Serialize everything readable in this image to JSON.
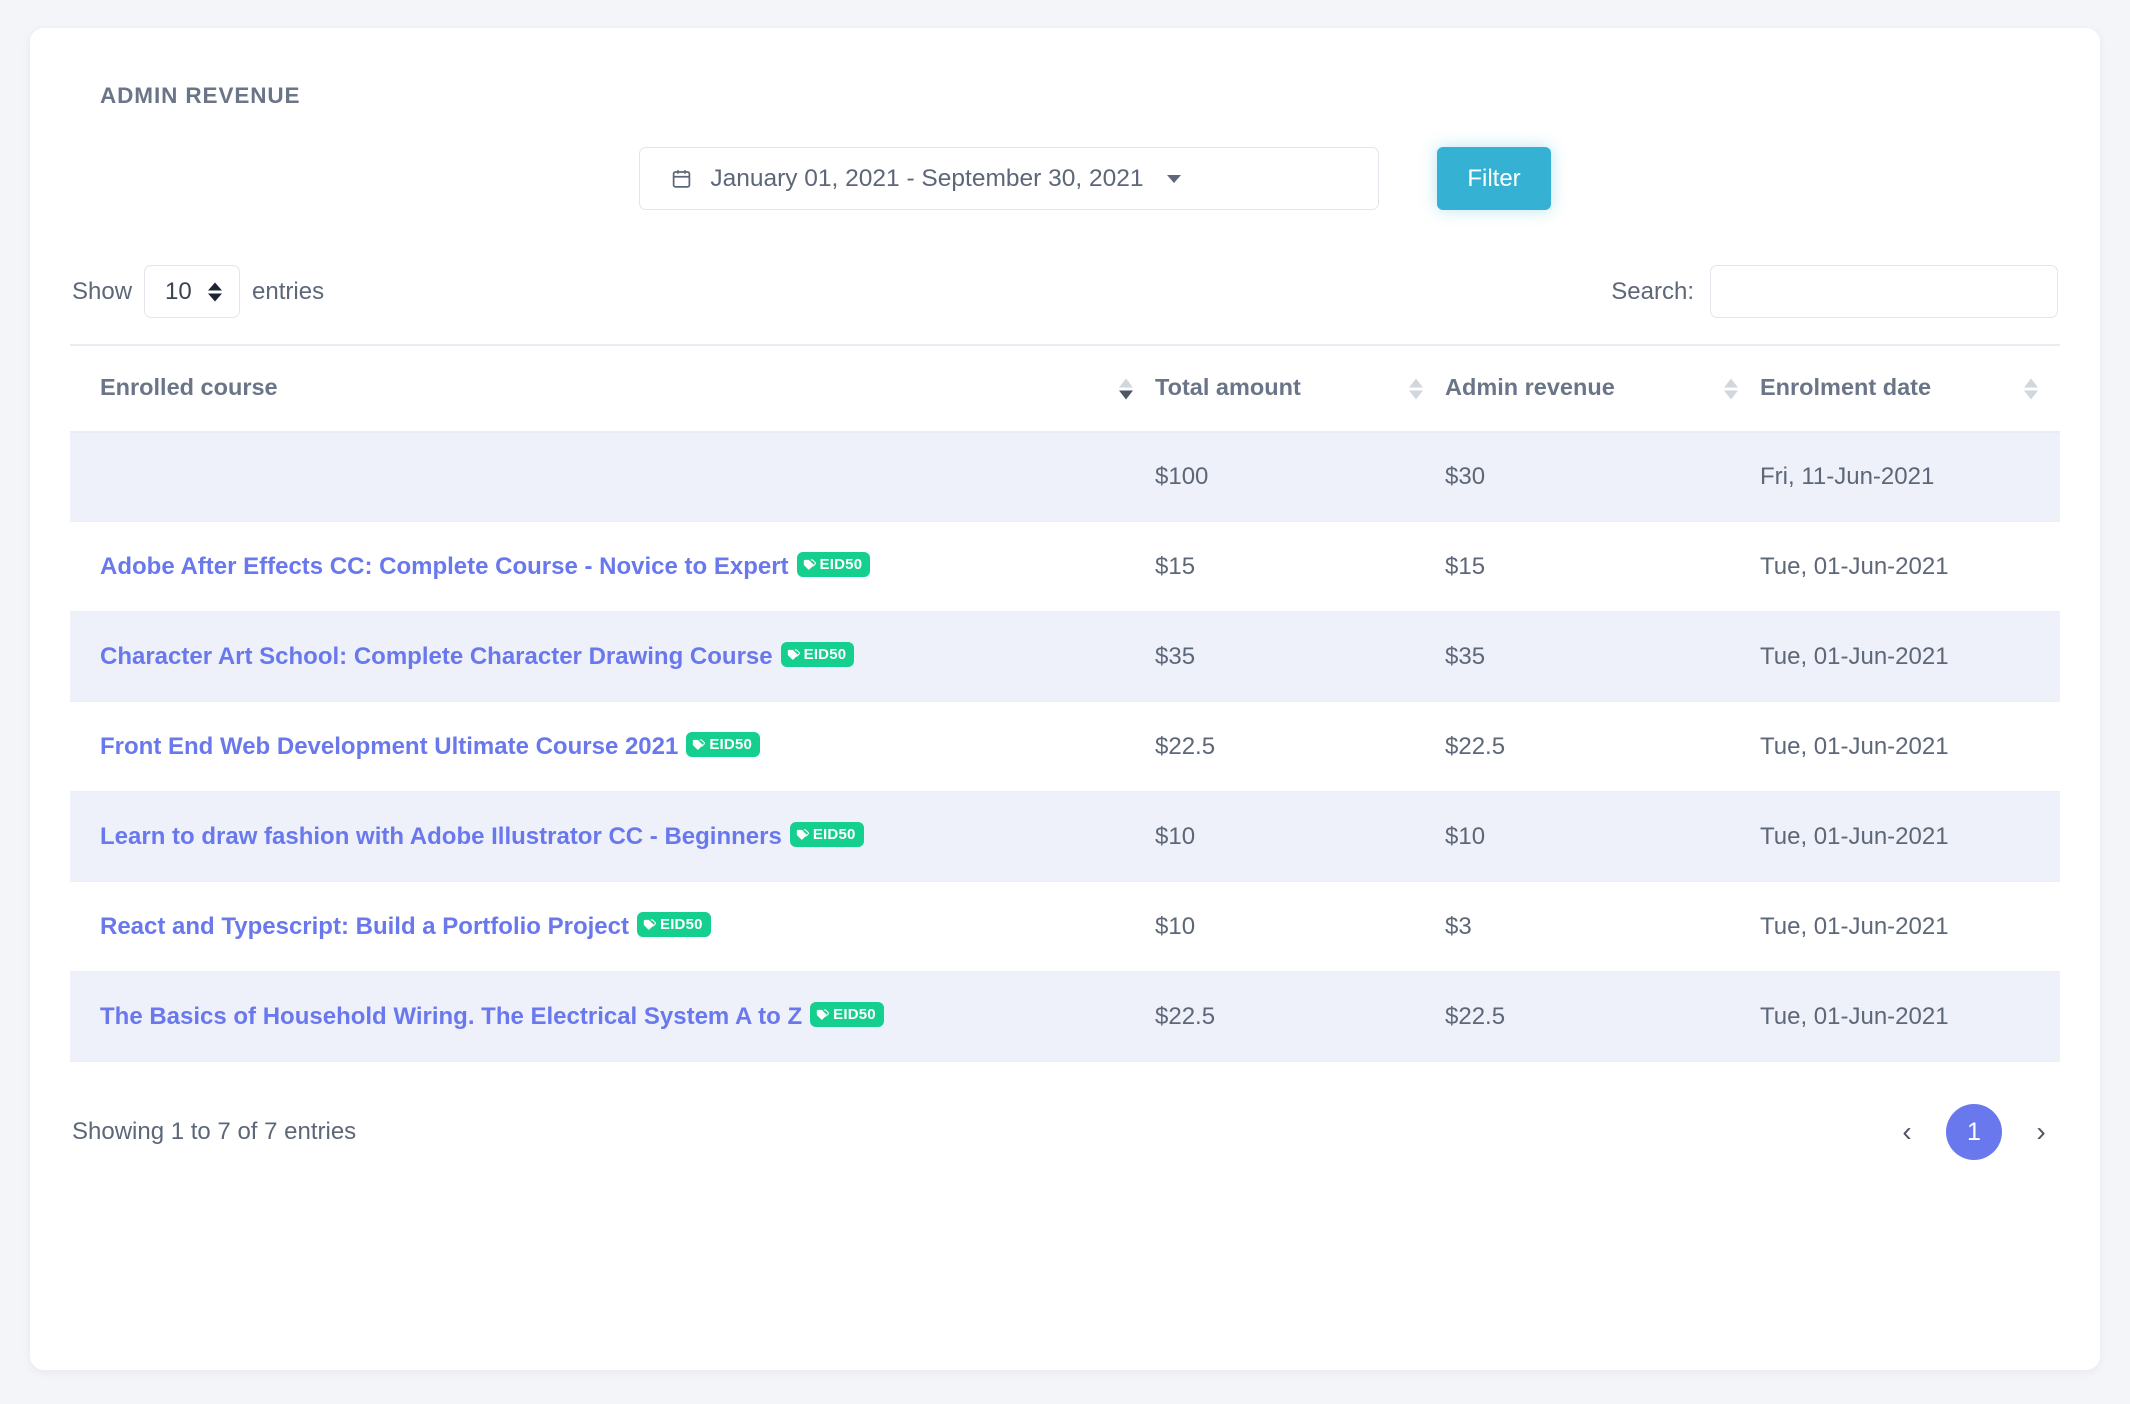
{
  "card": {
    "title": "ADMIN REVENUE"
  },
  "filter": {
    "date_range": "January 01, 2021 - September 30, 2021",
    "calendar_icon": "calendar-icon",
    "caret_icon": "chevron-down-icon",
    "filter_button": "Filter",
    "filter_button_color": "#35b2d3"
  },
  "controls": {
    "show_label": "Show",
    "entries_label": "entries",
    "page_length": "10",
    "search_label": "Search:",
    "search_value": "",
    "search_placeholder": ""
  },
  "table": {
    "columns": [
      {
        "key": "course",
        "label": "Enrolled course",
        "sort": "active"
      },
      {
        "key": "total",
        "label": "Total amount",
        "sort": "none"
      },
      {
        "key": "admin",
        "label": "Admin revenue",
        "sort": "none"
      },
      {
        "key": "date",
        "label": "Enrolment date",
        "sort": "none"
      }
    ],
    "badge_label": "EID50",
    "badge_color": "#14cf8e",
    "link_color": "#6a78ee",
    "rows": [
      {
        "course": "",
        "has_badge": false,
        "total": "$100",
        "admin": "$30",
        "date": "Fri, 11-Jun-2021"
      },
      {
        "course": "Adobe After Effects CC: Complete Course - Novice to Expert",
        "has_badge": true,
        "total": "$15",
        "admin": "$15",
        "date": "Tue, 01-Jun-2021"
      },
      {
        "course": "Character Art School: Complete Character Drawing Course",
        "has_badge": true,
        "total": "$35",
        "admin": "$35",
        "date": "Tue, 01-Jun-2021"
      },
      {
        "course": "Front End Web Development Ultimate Course 2021",
        "has_badge": true,
        "total": "$22.5",
        "admin": "$22.5",
        "date": "Tue, 01-Jun-2021"
      },
      {
        "course": "Learn to draw fashion with Adobe Illustrator CC - Beginners",
        "has_badge": true,
        "total": "$10",
        "admin": "$10",
        "date": "Tue, 01-Jun-2021"
      },
      {
        "course": "React and Typescript: Build a Portfolio Project",
        "has_badge": true,
        "total": "$10",
        "admin": "$3",
        "date": "Tue, 01-Jun-2021"
      },
      {
        "course": "The Basics of Household Wiring. The Electrical System A to Z",
        "has_badge": true,
        "total": "$22.5",
        "admin": "$22.5",
        "date": "Tue, 01-Jun-2021"
      }
    ]
  },
  "footer": {
    "showing_info": "Showing 1 to 7 of 7 entries",
    "prev_icon": "‹",
    "next_icon": "›",
    "current_page": "1"
  }
}
